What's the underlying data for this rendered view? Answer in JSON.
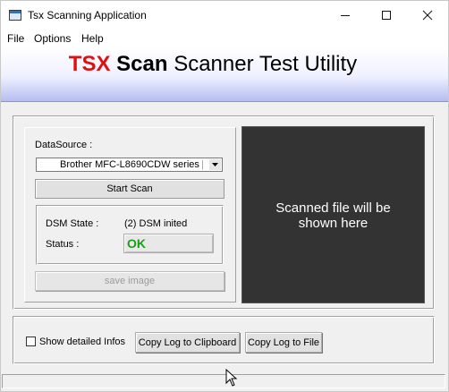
{
  "window": {
    "title": "Tsx Scanning Application"
  },
  "menu": {
    "items": [
      "File",
      "Options",
      "Help"
    ]
  },
  "header": {
    "part1": "TSX",
    "part2": "Scan",
    "part3": "Scanner Test Utility"
  },
  "datasource": {
    "label": "DataSource :",
    "selected": "Brother MFC-L8690CDW series ["
  },
  "buttons": {
    "start_scan": "Start Scan",
    "save_image": "save image",
    "copy_clipboard": "Copy Log to Clipboard",
    "copy_file": "Copy Log to File"
  },
  "status": {
    "dsm_label": "DSM State :",
    "dsm_value": "(2) DSM inited",
    "status_label": "Status :",
    "status_value": "OK",
    "status_color": "#1a9e1a"
  },
  "preview": {
    "placeholder_line1": "Scanned file will be",
    "placeholder_line2": "shown here"
  },
  "options": {
    "show_detailed_label": "Show detailed Infos",
    "show_detailed_checked": false
  },
  "colors": {
    "brand_red": "#e01010",
    "preview_bg": "#333333"
  }
}
